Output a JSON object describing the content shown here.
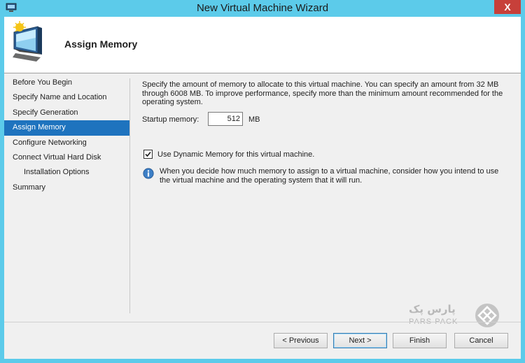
{
  "window": {
    "title": "New Virtual Machine Wizard",
    "close_label": "X"
  },
  "header": {
    "page_title": "Assign Memory"
  },
  "nav": {
    "items": [
      {
        "label": "Before You Begin",
        "selected": false,
        "sub": false
      },
      {
        "label": "Specify Name and Location",
        "selected": false,
        "sub": false
      },
      {
        "label": "Specify Generation",
        "selected": false,
        "sub": false
      },
      {
        "label": "Assign Memory",
        "selected": true,
        "sub": false
      },
      {
        "label": "Configure Networking",
        "selected": false,
        "sub": false
      },
      {
        "label": "Connect Virtual Hard Disk",
        "selected": false,
        "sub": false
      },
      {
        "label": "Installation Options",
        "selected": false,
        "sub": true
      },
      {
        "label": "Summary",
        "selected": false,
        "sub": false
      }
    ]
  },
  "content": {
    "description": "Specify the amount of memory to allocate to this virtual machine. You can specify an amount from 32 MB through 6008 MB. To improve performance, specify more than the minimum amount recommended for the operating system.",
    "startup_label": "Startup memory:",
    "startup_value": "512",
    "startup_unit": "MB",
    "dynamic_label": "Use Dynamic Memory for this virtual machine.",
    "dynamic_checked": true,
    "info_text": "When you decide how much memory to assign to a virtual machine, consider how you intend to use the virtual machine and the operating system that it will run."
  },
  "watermark": {
    "persian": "پارس پک",
    "latin": "Pars Pack"
  },
  "buttons": {
    "previous": "< Previous",
    "next": "Next >",
    "finish": "Finish",
    "cancel": "Cancel"
  },
  "colors": {
    "titlebar": "#5ccbea",
    "selection": "#1e73be",
    "close": "#c7403a"
  }
}
